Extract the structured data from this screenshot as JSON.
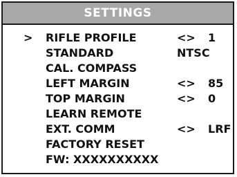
{
  "title": "SETTINGS",
  "cursor": ">",
  "items": [
    {
      "label": "RIFLE PROFILE",
      "arrows": "<>",
      "value": "1"
    },
    {
      "label": "STANDARD",
      "value": "NTSC"
    },
    {
      "label": "CAL. COMPASS"
    },
    {
      "label": "LEFT MARGIN",
      "arrows": "<>",
      "value": "85"
    },
    {
      "label": "TOP MARGIN",
      "arrows": "<>",
      "value": "0"
    },
    {
      "label": "LEARN REMOTE"
    },
    {
      "label": "EXT. COMM",
      "arrows": "<>",
      "value": "LRF"
    },
    {
      "label": "FACTORY RESET"
    },
    {
      "label": "FW: XXXXXXXXXX"
    }
  ]
}
